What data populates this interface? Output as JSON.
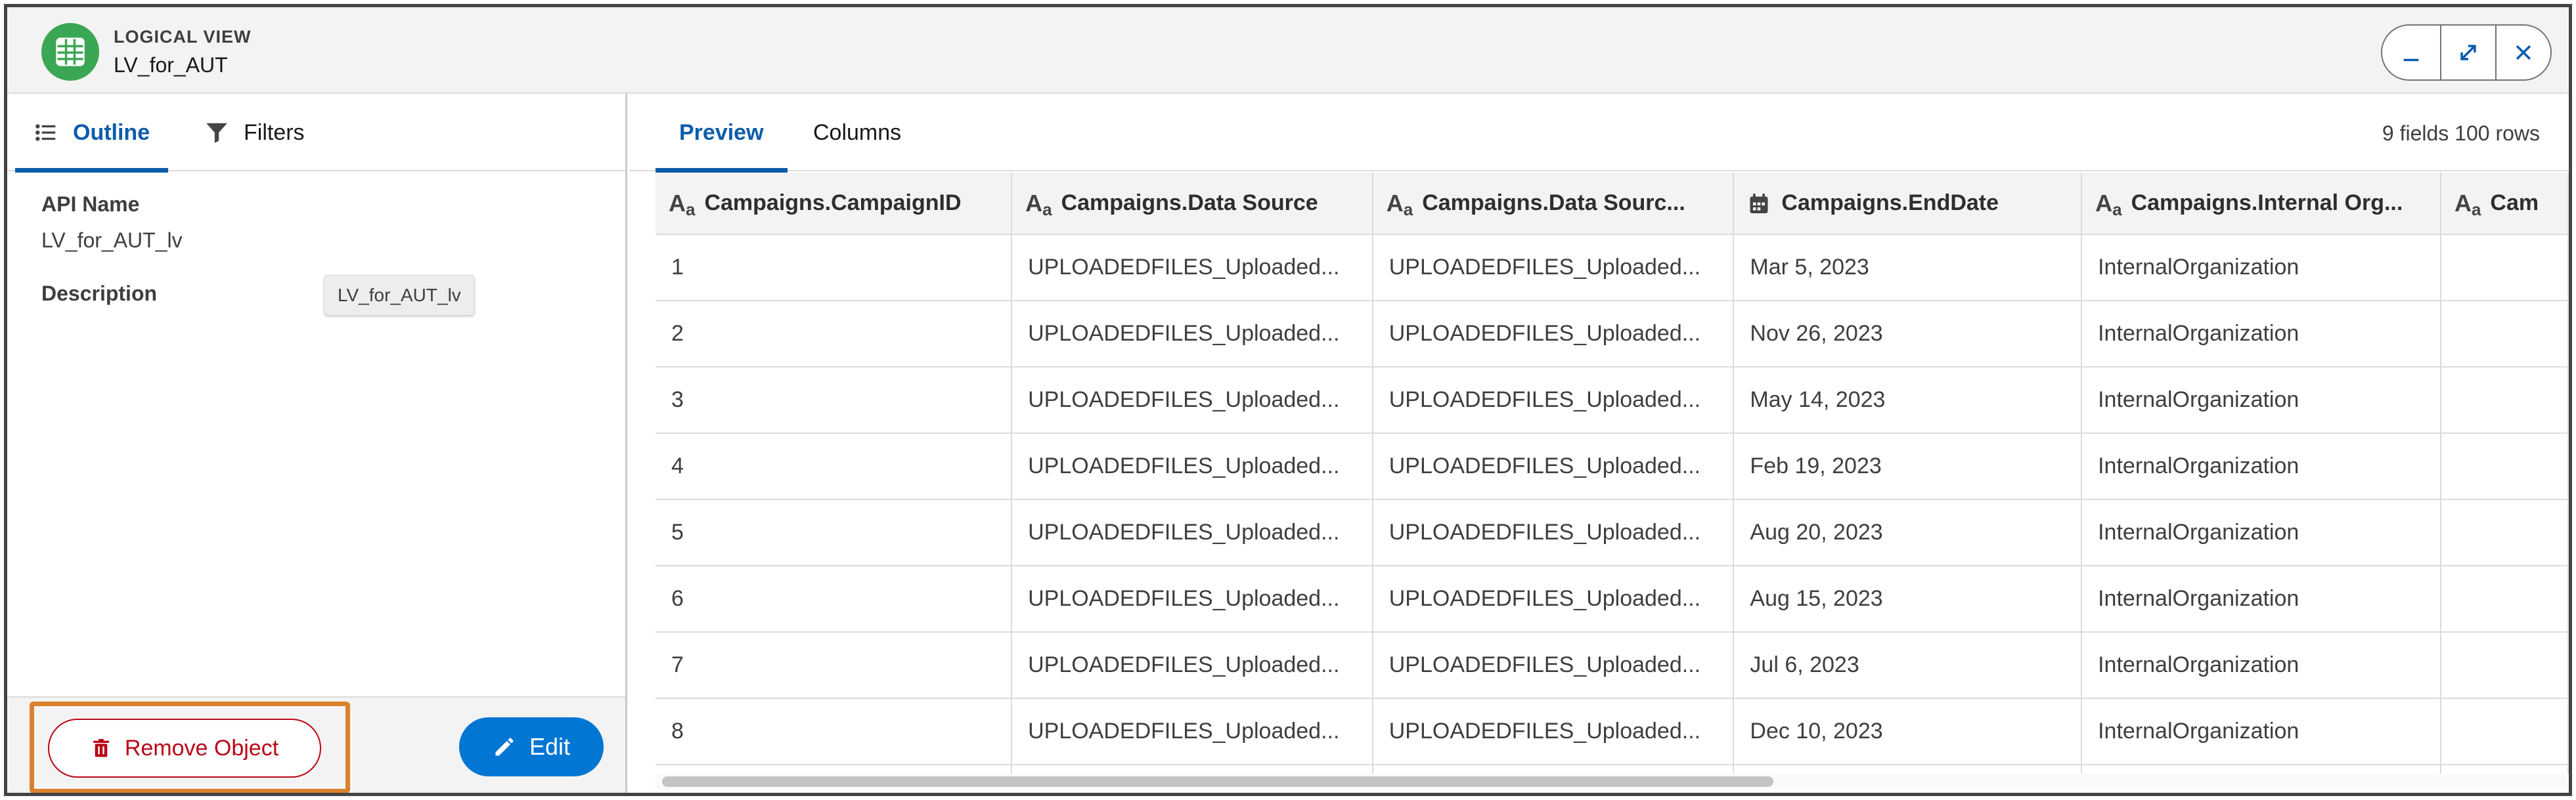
{
  "header": {
    "object_type": "LOGICAL VIEW",
    "object_name": "LV_for_AUT",
    "icon": "table-icon",
    "window_buttons": [
      "minimize-icon",
      "expand-icon",
      "close-icon"
    ]
  },
  "left_panel": {
    "tabs": [
      {
        "label": "Outline",
        "icon": "list-icon",
        "active": true
      },
      {
        "label": "Filters",
        "icon": "filter-icon",
        "active": false
      }
    ],
    "api_name_label": "API Name",
    "api_name_value": "LV_for_AUT_lv",
    "description_label": "Description",
    "tooltip_text": "LV_for_AUT_lv",
    "remove_button": "Remove Object",
    "edit_button": "Edit"
  },
  "right_panel": {
    "tabs": [
      {
        "label": "Preview",
        "active": true
      },
      {
        "label": "Columns",
        "active": false
      }
    ],
    "meta": "9 fields 100 rows",
    "columns": [
      {
        "label": "Campaigns.CampaignID",
        "type": "text"
      },
      {
        "label": "Campaigns.Data Source",
        "type": "text"
      },
      {
        "label": "Campaigns.Data Sourc...",
        "type": "text"
      },
      {
        "label": "Campaigns.EndDate",
        "type": "date"
      },
      {
        "label": "Campaigns.Internal Org...",
        "type": "text"
      },
      {
        "label": "Cam",
        "type": "text"
      }
    ],
    "rows": [
      [
        "1",
        "UPLOADEDFILES_Uploaded...",
        "UPLOADEDFILES_Uploaded...",
        "Mar 5, 2023",
        "InternalOrganization",
        ""
      ],
      [
        "2",
        "UPLOADEDFILES_Uploaded...",
        "UPLOADEDFILES_Uploaded...",
        "Nov 26, 2023",
        "InternalOrganization",
        ""
      ],
      [
        "3",
        "UPLOADEDFILES_Uploaded...",
        "UPLOADEDFILES_Uploaded...",
        "May 14, 2023",
        "InternalOrganization",
        ""
      ],
      [
        "4",
        "UPLOADEDFILES_Uploaded...",
        "UPLOADEDFILES_Uploaded...",
        "Feb 19, 2023",
        "InternalOrganization",
        ""
      ],
      [
        "5",
        "UPLOADEDFILES_Uploaded...",
        "UPLOADEDFILES_Uploaded...",
        "Aug 20, 2023",
        "InternalOrganization",
        ""
      ],
      [
        "6",
        "UPLOADEDFILES_Uploaded...",
        "UPLOADEDFILES_Uploaded...",
        "Aug 15, 2023",
        "InternalOrganization",
        ""
      ],
      [
        "7",
        "UPLOADEDFILES_Uploaded...",
        "UPLOADEDFILES_Uploaded...",
        "Jul 6, 2023",
        "InternalOrganization",
        ""
      ],
      [
        "8",
        "UPLOADEDFILES_Uploaded...",
        "UPLOADEDFILES_Uploaded...",
        "Dec 10, 2023",
        "InternalOrganization",
        ""
      ],
      [
        "",
        "",
        "",
        "",
        "",
        ""
      ]
    ]
  },
  "colors": {
    "accent": "#0b5cab",
    "brand_button": "#0176d3",
    "destructive": "#ba0517",
    "highlight": "#d9822b",
    "object_icon": "#3ba755"
  }
}
